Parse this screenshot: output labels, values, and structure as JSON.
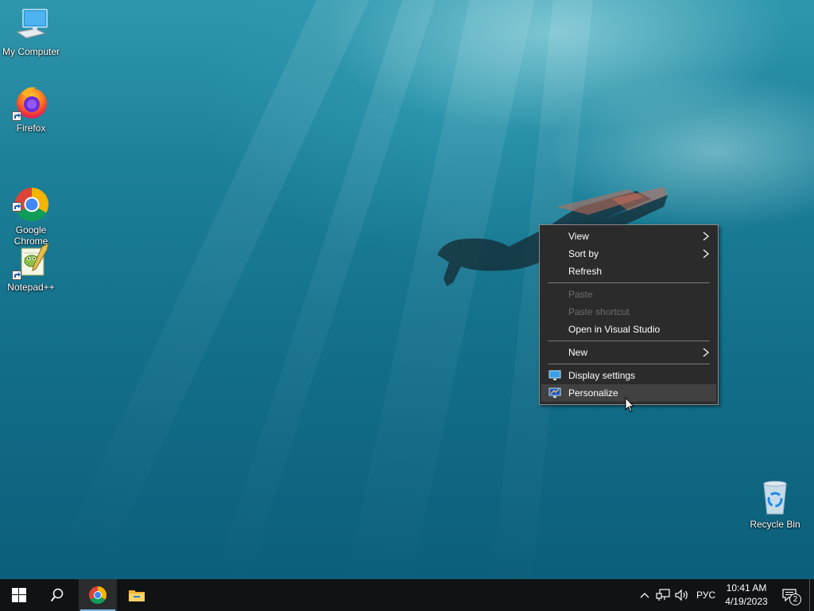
{
  "desktop": {
    "icons": [
      {
        "label": "My Computer",
        "icon": "computer-icon"
      },
      {
        "label": "Firefox",
        "icon": "firefox-icon"
      },
      {
        "label": "Google\nChrome",
        "icon": "chrome-icon"
      },
      {
        "label": "Notepad++",
        "icon": "notepadplusplus-icon"
      },
      {
        "label": "Recycle Bin",
        "icon": "recycle-bin-icon"
      }
    ]
  },
  "context_menu": {
    "items": [
      {
        "label": "View",
        "submenu": true,
        "enabled": true
      },
      {
        "label": "Sort by",
        "submenu": true,
        "enabled": true
      },
      {
        "label": "Refresh",
        "submenu": false,
        "enabled": true
      },
      {
        "label": "Paste",
        "submenu": false,
        "enabled": false
      },
      {
        "label": "Paste shortcut",
        "submenu": false,
        "enabled": false
      },
      {
        "label": "Open in Visual Studio",
        "submenu": false,
        "enabled": true
      },
      {
        "label": "New",
        "submenu": true,
        "enabled": true
      },
      {
        "label": "Display settings",
        "submenu": false,
        "enabled": true,
        "icon": "display-settings-icon"
      },
      {
        "label": "Personalize",
        "submenu": false,
        "enabled": true,
        "icon": "personalize-icon",
        "hovered": true
      }
    ]
  },
  "taskbar": {
    "buttons": [
      "start-icon",
      "search-icon",
      "chrome-icon",
      "file-explorer-icon"
    ],
    "tray": {
      "language": "РУС",
      "time": "10:41 AM",
      "date": "4/19/2023",
      "notification_count": "2"
    }
  },
  "colors": {
    "taskbar_bg": "#101214",
    "menu_bg": "#2b2b2b",
    "menu_highlight": "#414141",
    "accent": "#76b9ed"
  }
}
